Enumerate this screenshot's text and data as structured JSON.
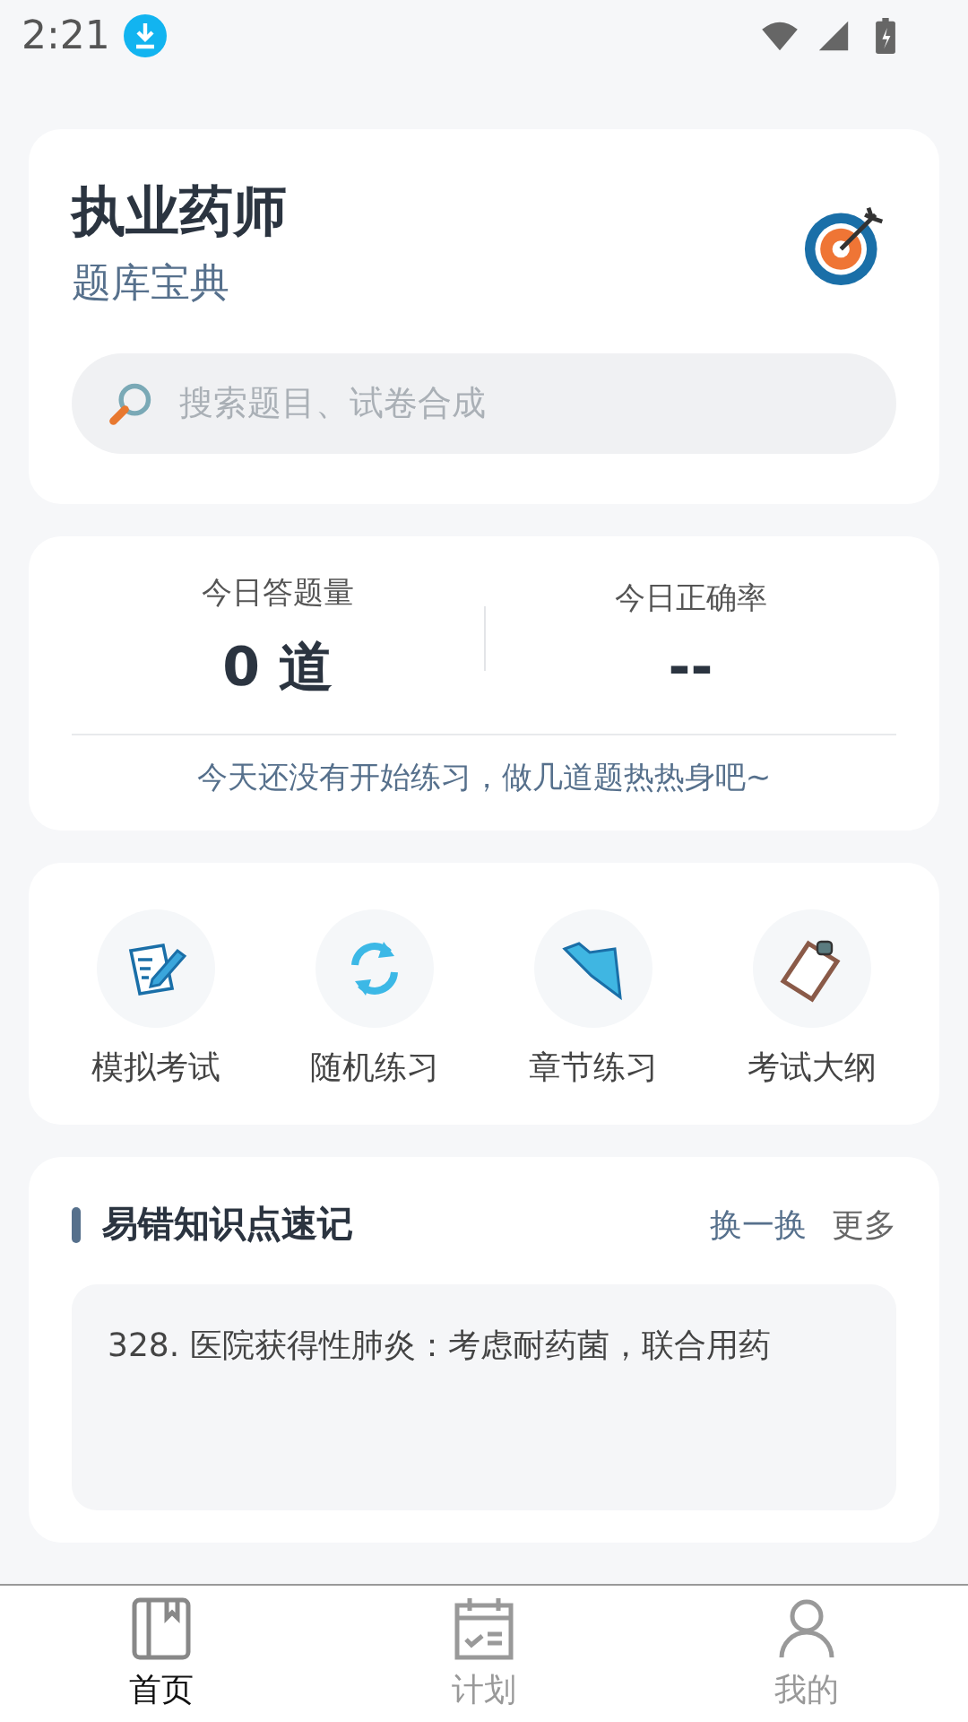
{
  "status_bar": {
    "time": "2:21"
  },
  "header": {
    "title": "执业药师",
    "subtitle": "题库宝典",
    "search": {
      "placeholder": "搜索题目、试卷合成"
    }
  },
  "stats": {
    "items": [
      {
        "label": "今日答题量",
        "value": "0 道"
      },
      {
        "label": "今日正确率",
        "value": "--"
      }
    ],
    "hint": "今天还没有开始练习，做几道题热热身吧~"
  },
  "shortcuts": [
    {
      "kind": "exam",
      "label": "模拟考试"
    },
    {
      "kind": "random",
      "label": "随机练习"
    },
    {
      "kind": "chapter",
      "label": "章节练习"
    },
    {
      "kind": "outline",
      "label": "考试大纲"
    }
  ],
  "tips": {
    "title": "易错知识点速记",
    "actions": [
      "换一换",
      "更多"
    ],
    "text": "328. 医院获得性肺炎：考虑耐药菌，联合用药"
  },
  "tabs": [
    {
      "kind": "home",
      "label": "首页",
      "selected": true
    },
    {
      "kind": "plan",
      "label": "计划",
      "selected": false
    },
    {
      "kind": "me",
      "label": "我的",
      "selected": false
    }
  ]
}
